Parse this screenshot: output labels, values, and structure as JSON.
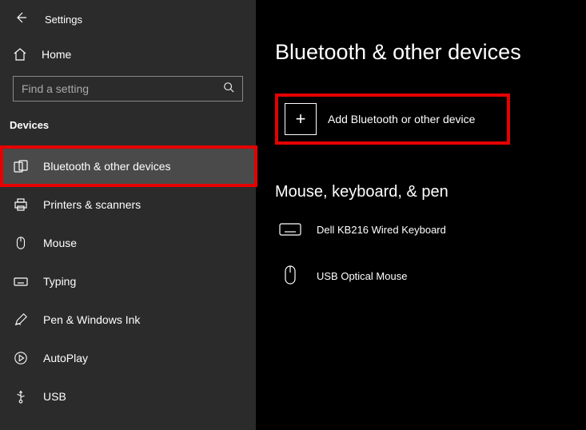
{
  "header": {
    "title": "Settings"
  },
  "home": {
    "label": "Home"
  },
  "search": {
    "placeholder": "Find a setting"
  },
  "section": {
    "title": "Devices"
  },
  "nav": [
    {
      "label": "Bluetooth & other devices",
      "selected": true,
      "highlight": true,
      "icon": "bluetooth-devices"
    },
    {
      "label": "Printers & scanners",
      "icon": "printer"
    },
    {
      "label": "Mouse",
      "icon": "mouse"
    },
    {
      "label": "Typing",
      "icon": "keyboard"
    },
    {
      "label": "Pen & Windows Ink",
      "icon": "pen"
    },
    {
      "label": "AutoPlay",
      "icon": "autoplay"
    },
    {
      "label": "USB",
      "icon": "usb"
    }
  ],
  "main": {
    "title": "Bluetooth & other devices",
    "add_label": "Add Bluetooth or other device",
    "sub_title": "Mouse, keyboard, & pen",
    "devices": [
      {
        "label": "Dell KB216 Wired Keyboard",
        "icon": "keyboard"
      },
      {
        "label": "USB Optical Mouse",
        "icon": "mouse"
      }
    ]
  }
}
